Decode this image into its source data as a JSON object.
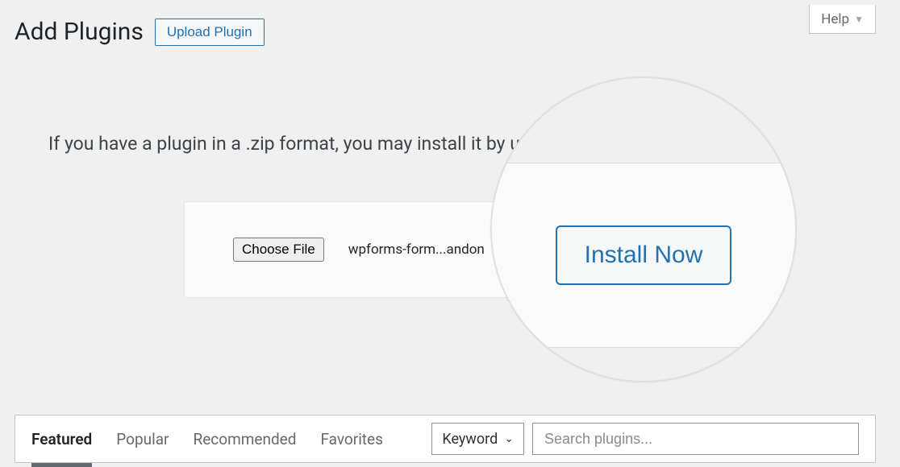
{
  "help_label": "Help",
  "page_title": "Add Plugins",
  "upload_button": "Upload Plugin",
  "intro_text": "If you have a plugin in a .zip format, you may install it by uploading it here.",
  "upload": {
    "choose_label": "Choose File",
    "file_name": "wpforms-form...andon",
    "install_label": "Install Now"
  },
  "tabs": {
    "featured": "Featured",
    "popular": "Popular",
    "recommended": "Recommended",
    "favorites": "Favorites"
  },
  "search": {
    "filter_label": "Keyword",
    "placeholder": "Search plugins..."
  }
}
